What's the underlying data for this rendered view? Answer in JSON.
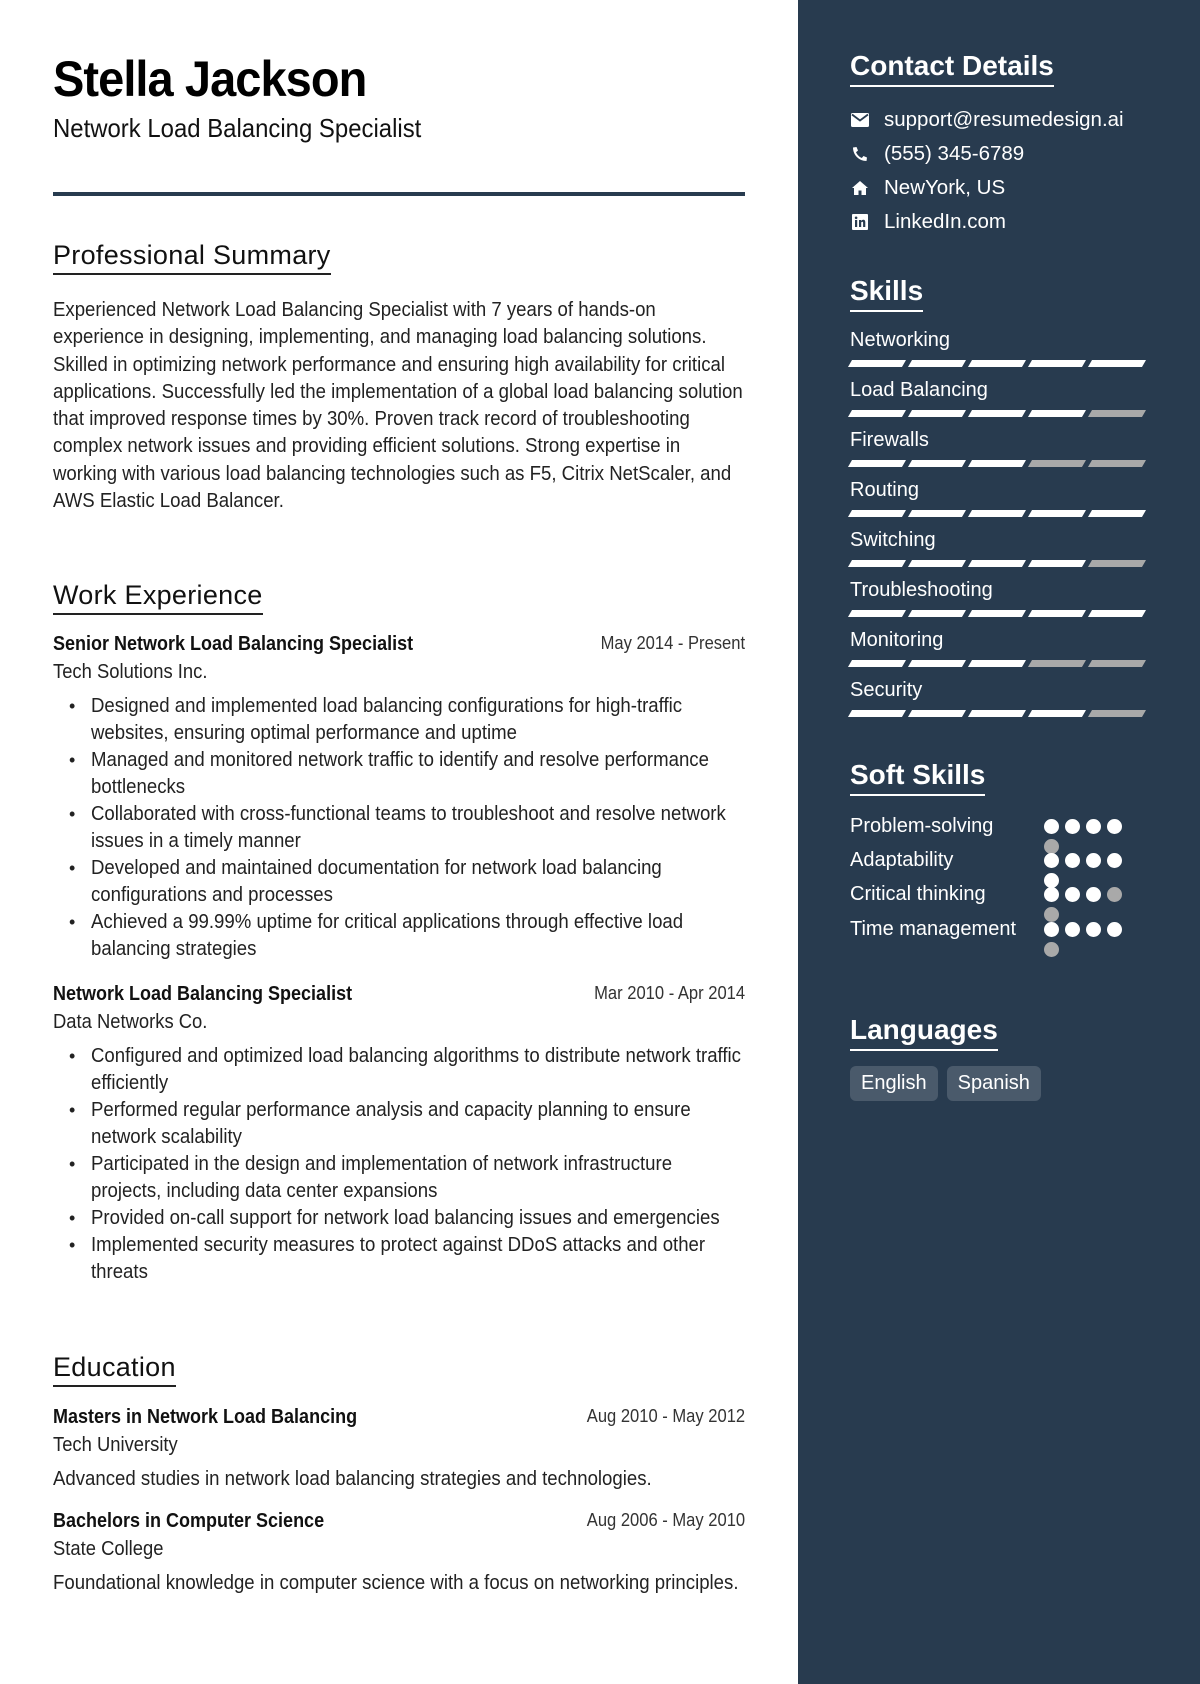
{
  "header": {
    "name": "Stella Jackson",
    "title": "Network Load Balancing Specialist"
  },
  "summary": {
    "heading": "Professional Summary",
    "text": "Experienced Network Load Balancing Specialist with 7 years of hands-on experience in designing, implementing, and managing load balancing solutions. Skilled in optimizing network performance and ensuring high availability for critical applications. Successfully led the implementation of a global load balancing solution that improved response times by 30%. Proven track record of troubleshooting complex network issues and providing efficient solutions. Strong expertise in working with various load balancing technologies such as F5, Citrix NetScaler, and AWS Elastic Load Balancer."
  },
  "experience": {
    "heading": "Work Experience",
    "jobs": [
      {
        "title": "Senior Network Load Balancing Specialist",
        "dates": "May 2014 - Present",
        "company": "Tech Solutions Inc.",
        "bullets": [
          "Designed and implemented load balancing configurations for high-traffic websites, ensuring optimal performance and uptime",
          "Managed and monitored network traffic to identify and resolve performance bottlenecks",
          "Collaborated with cross-functional teams to troubleshoot and resolve network issues in a timely manner",
          "Developed and maintained documentation for network load balancing configurations and processes",
          "Achieved a 99.99% uptime for critical applications through effective load balancing strategies"
        ]
      },
      {
        "title": "Network Load Balancing Specialist",
        "dates": "Mar 2010 - Apr 2014",
        "company": "Data Networks Co.",
        "bullets": [
          "Configured and optimized load balancing algorithms to distribute network traffic efficiently",
          "Performed regular performance analysis and capacity planning to ensure network scalability",
          "Participated in the design and implementation of network infrastructure projects, including data center expansions",
          "Provided on-call support for network load balancing issues and emergencies",
          "Implemented security measures to protect against DDoS attacks and other threats"
        ]
      }
    ]
  },
  "education": {
    "heading": "Education",
    "items": [
      {
        "degree": "Masters in Network Load Balancing",
        "dates": "Aug 2010 - May 2012",
        "school": "Tech University",
        "description": "Advanced studies in network load balancing strategies and technologies."
      },
      {
        "degree": "Bachelors in Computer Science",
        "dates": "Aug 2006 - May 2010",
        "school": "State College",
        "description": "Foundational knowledge in computer science with a focus on networking principles."
      }
    ]
  },
  "sidebar": {
    "contact": {
      "heading": "Contact Details",
      "items": [
        {
          "icon": "envelope-icon",
          "text": "support@resumedesign.ai"
        },
        {
          "icon": "phone-icon",
          "text": "(555) 345-6789"
        },
        {
          "icon": "home-icon",
          "text": "NewYork, US"
        },
        {
          "icon": "linkedin-icon",
          "text": "LinkedIn.com"
        }
      ]
    },
    "skills": {
      "heading": "Skills",
      "max": 5,
      "items": [
        {
          "name": "Networking",
          "level": 5
        },
        {
          "name": "Load Balancing",
          "level": 4
        },
        {
          "name": "Firewalls",
          "level": 3
        },
        {
          "name": "Routing",
          "level": 5
        },
        {
          "name": "Switching",
          "level": 4
        },
        {
          "name": "Troubleshooting",
          "level": 5
        },
        {
          "name": "Monitoring",
          "level": 3
        },
        {
          "name": "Security",
          "level": 4
        }
      ]
    },
    "soft_skills": {
      "heading": "Soft Skills",
      "max": 5,
      "items": [
        {
          "name": "Problem-solving",
          "level": 4
        },
        {
          "name": "Adaptability",
          "level": 5
        },
        {
          "name": "Critical thinking",
          "level": 3
        },
        {
          "name": "Time management",
          "level": 4
        }
      ]
    },
    "languages": {
      "heading": "Languages",
      "items": [
        "English",
        "Spanish"
      ]
    }
  },
  "colors": {
    "sidebar_bg": "#283b4f",
    "accent": "#283b4f",
    "rating_on": "#ffffff",
    "rating_off": "#a9a9a9",
    "language_chip": "#4a5a6b"
  }
}
